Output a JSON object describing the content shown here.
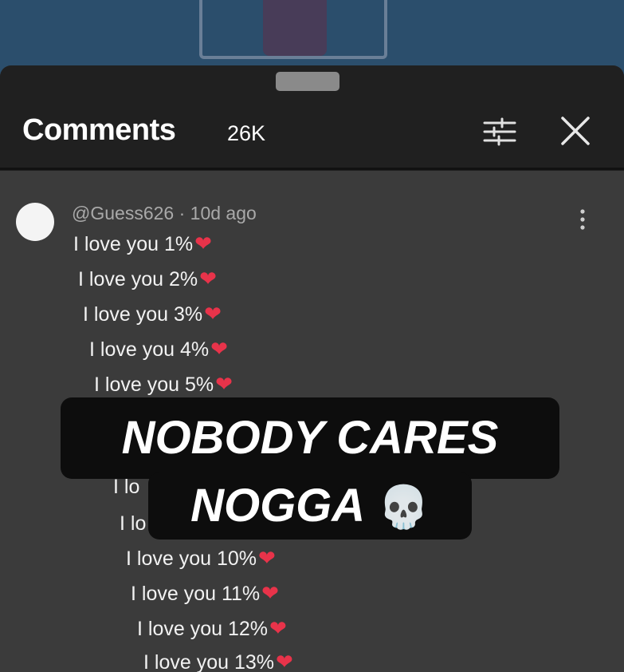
{
  "header": {
    "title": "Comments",
    "count": "26K",
    "icons": {
      "filter": "sliders-icon",
      "close": "close-icon"
    }
  },
  "comment": {
    "author": "@Guess626",
    "separator": " · ",
    "age": "10d ago",
    "lines": [
      "I love you 1%",
      "I love you 2%",
      "I love you 3%",
      "I love you 4%",
      "I love you 5%",
      "I lo",
      "I lo",
      "I love you 10%",
      "I love you 11%",
      "I love you 12%",
      "I love you 13%"
    ],
    "heart_emoji": "❤",
    "more_icon": "kebab-menu-icon"
  },
  "overlay": {
    "line1": "NOBODY CARES",
    "line2": "NOGGA",
    "emoji": "💀"
  },
  "colors": {
    "sheet": "#3a3a3a",
    "header": "#202020",
    "heart": "#e8334a",
    "caption_bg": "#0d0d0d"
  }
}
